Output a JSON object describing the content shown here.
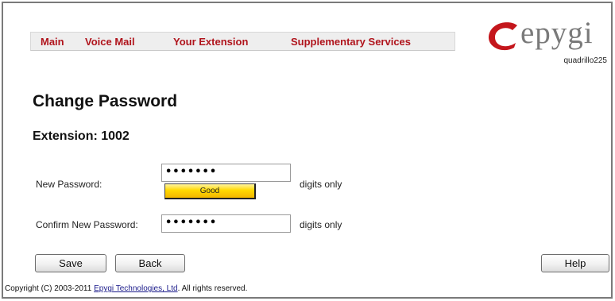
{
  "nav": {
    "items": [
      "Main",
      "Voice Mail",
      "Your Extension",
      "Supplementary Services"
    ]
  },
  "logo": {
    "text": "epygi",
    "device_name": "quadrillo225",
    "accent_color": "#c4161c"
  },
  "page": {
    "title": "Change Password",
    "extension_label": "Extension: 1002"
  },
  "form": {
    "new_password": {
      "label": "New Password:",
      "value": "•••••••",
      "hint": "digits only",
      "strength_label": "Good"
    },
    "confirm_password": {
      "label": "Confirm New Password:",
      "value": "•••••••",
      "hint": "digits only"
    }
  },
  "buttons": {
    "save": "Save",
    "back": "Back",
    "help": "Help"
  },
  "footer": {
    "prefix": "Copyright (C) 2003-2011 ",
    "link": "Epygi Technologies, Ltd",
    "suffix": ". All rights reserved."
  }
}
